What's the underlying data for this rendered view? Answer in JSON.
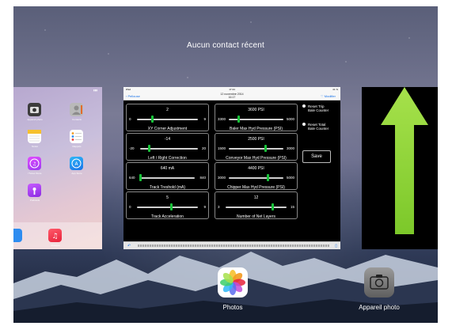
{
  "switcher": {
    "recent_contacts": "Aucun contact récent"
  },
  "left_card": {
    "apps": [
      {
        "name": "Appareil photo"
      },
      {
        "name": "Contacts"
      },
      {
        "name": "Notes"
      },
      {
        "name": "Rappels"
      },
      {
        "name": "iTunes Store"
      },
      {
        "name": "App Store"
      },
      {
        "name": "Podcasts"
      }
    ],
    "dock": [
      {
        "name": "Musique"
      }
    ]
  },
  "center_card": {
    "status_carrier": "iPad",
    "status_time": "17:44",
    "status_battery": "41 %",
    "nav_back": "Pellouse",
    "nav_date": "12 novembre 2014",
    "nav_subdate": "16:17",
    "nav_edit": "Modifier",
    "panels": [
      {
        "value": "2",
        "min": "0",
        "max": "9",
        "label": "XY Corner Adjustment",
        "fraction": 0.25
      },
      {
        "value": "3600 PSI",
        "min": "3300",
        "max": "5000",
        "label": "Baler Max Hyd Pressure (PSI)",
        "fraction": 0.18
      },
      {
        "value": "-14",
        "min": "-20",
        "max": "20",
        "label": "Left / Right Correction",
        "fraction": 0.15
      },
      {
        "value": "2500 PSI",
        "min": "1500",
        "max": "3000",
        "label": "Conveyor Max Hyd Pressure (PSI)",
        "fraction": 0.66
      },
      {
        "value": "640 mA",
        "min": "640",
        "max": "840",
        "label": "Track Treshold (mA)",
        "fraction": 0.0
      },
      {
        "value": "4400 PSI",
        "min": "3000",
        "max": "5000",
        "label": "Chipper Max Hyd Pressure (PSI)",
        "fraction": 0.7
      },
      {
        "value": "5",
        "min": "0",
        "max": "9",
        "label": "Track Acceleration",
        "fraction": 0.55
      },
      {
        "value": "12",
        "min": "3",
        "max": "15",
        "label": "Number of Net Layers",
        "fraction": 0.75
      }
    ],
    "options": [
      {
        "line1": "Reset Trip",
        "line2": "Bale Counter"
      },
      {
        "line1": "Reset Total",
        "line2": "Bale Counter"
      }
    ],
    "save_label": "Save"
  },
  "bottom_apps": {
    "photos": "Photos",
    "camera": "Appareil photo"
  },
  "colors": {
    "slider_thumb": "#19c23a",
    "arrow": "#8ad42e",
    "link_blue": "#1a73e8"
  }
}
